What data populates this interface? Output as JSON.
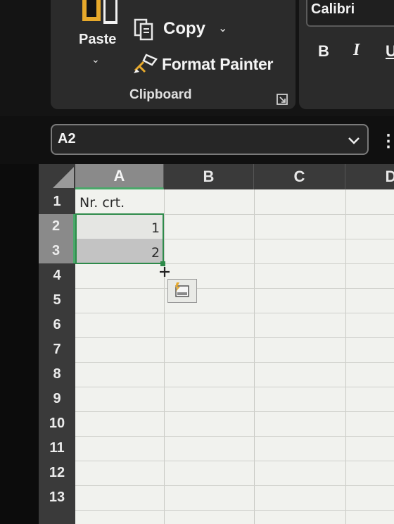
{
  "clipboard": {
    "paste_label": "Paste",
    "copy_label": "Copy",
    "format_painter_label": "Format Painter",
    "group_label": "Clipboard"
  },
  "font": {
    "name": "Calibri",
    "bold": "B",
    "italic": "I",
    "underline": "U"
  },
  "name_box": {
    "value": "A2"
  },
  "formula_bar": {
    "more": "⋮"
  },
  "grid": {
    "columns": [
      "A",
      "B",
      "C",
      "D"
    ],
    "rows": [
      "1",
      "2",
      "3",
      "4",
      "5",
      "6",
      "7",
      "8",
      "9",
      "10",
      "11",
      "12",
      "13"
    ],
    "cells": {
      "A1": "Nr. crt.",
      "A2": "1",
      "A3": "2"
    },
    "selection": "A2:A3"
  },
  "colors": {
    "ribbon_bg": "#2b2b2b",
    "accent_green": "#2e8b4a",
    "paste_yellow": "#e7a92b"
  }
}
